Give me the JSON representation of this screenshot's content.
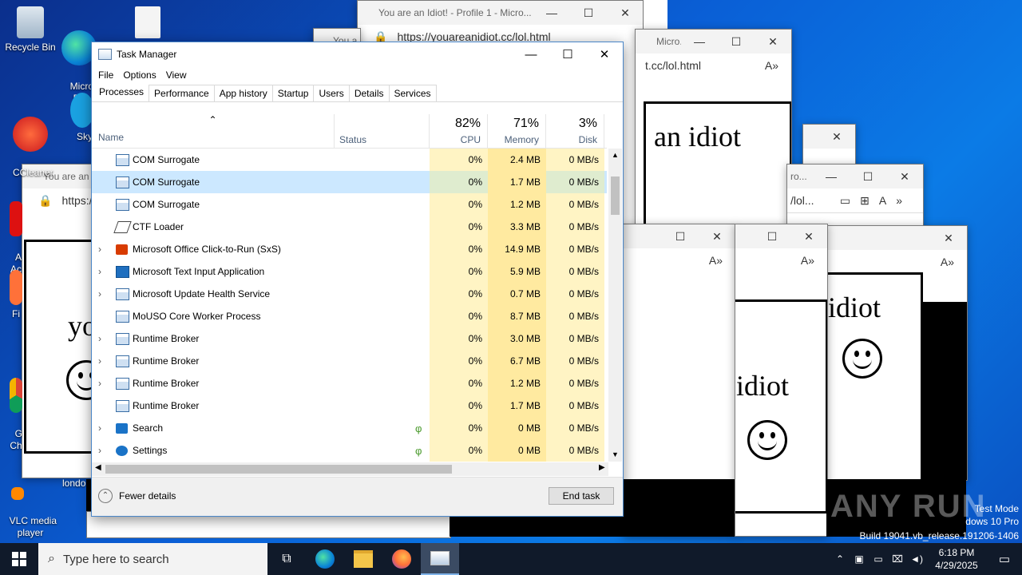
{
  "desktop": {
    "icons": [
      {
        "label": "Recycle Bin"
      },
      {
        "label": "Micro\nEd"
      },
      {
        "label": "CCleaner"
      },
      {
        "label": "Sky"
      },
      {
        "label": "A\nAc"
      },
      {
        "label": "Fi"
      },
      {
        "label": "Go\nCh"
      },
      {
        "label": "VLC media\nplayer"
      },
      {
        "label": "londo"
      }
    ],
    "watermark": {
      "brand": "ANY RUN",
      "mode": "Test Mode",
      "os": "dows 10 Pro",
      "build": "Build 19041.vb_release.191206-1406"
    }
  },
  "browsers": [
    {
      "title": "You are an Idiot! - Profile 1 - Micro...",
      "url": "https://youareanidiot.cc/lol.html",
      "text": ""
    },
    {
      "title": "Micro...",
      "url": "t.cc/lol.html",
      "text": "an idiot"
    },
    {
      "title": "You a",
      "url": "",
      "text": ""
    },
    {
      "title": "You are an I",
      "url": "https:/",
      "text": "yo"
    },
    {
      "title": "ro...",
      "url": "/lol...",
      "text": ""
    },
    {
      "title": "",
      "url": "",
      "text": "idiot"
    },
    {
      "title": "",
      "url": "",
      "text": "idiot"
    }
  ],
  "task_manager": {
    "title": "Task Manager",
    "menu": [
      "File",
      "Options",
      "View"
    ],
    "tabs": [
      "Processes",
      "Performance",
      "App history",
      "Startup",
      "Users",
      "Details",
      "Services"
    ],
    "columns": {
      "name": "Name",
      "status": "Status",
      "cpu": {
        "pct": "82%",
        "label": "CPU"
      },
      "memory": {
        "pct": "71%",
        "label": "Memory"
      },
      "disk": {
        "pct": "3%",
        "label": "Disk"
      }
    },
    "rows": [
      {
        "name": "COM Surrogate",
        "expand": "",
        "cpu": "0%",
        "mem": "2.4 MB",
        "disk": "0 MB/s",
        "icon": "app-window-icon"
      },
      {
        "name": "COM Surrogate",
        "expand": "",
        "cpu": "0%",
        "mem": "1.7 MB",
        "disk": "0 MB/s",
        "icon": "app-window-icon"
      },
      {
        "name": "COM Surrogate",
        "expand": "",
        "cpu": "0%",
        "mem": "1.2 MB",
        "disk": "0 MB/s",
        "icon": "app-window-icon"
      },
      {
        "name": "CTF Loader",
        "expand": "",
        "cpu": "0%",
        "mem": "3.3 MB",
        "disk": "0 MB/s",
        "icon": "pen-icon"
      },
      {
        "name": "Microsoft Office Click-to-Run (SxS)",
        "expand": "›",
        "cpu": "0%",
        "mem": "14.9 MB",
        "disk": "0 MB/s",
        "icon": "office-icon"
      },
      {
        "name": "Microsoft Text Input Application",
        "expand": "›",
        "cpu": "0%",
        "mem": "5.9 MB",
        "disk": "0 MB/s",
        "icon": "keyboard-icon"
      },
      {
        "name": "Microsoft Update Health Service",
        "expand": "›",
        "cpu": "0%",
        "mem": "0.7 MB",
        "disk": "0 MB/s",
        "icon": "app-window-icon"
      },
      {
        "name": "MoUSO Core Worker Process",
        "expand": "",
        "cpu": "0%",
        "mem": "8.7 MB",
        "disk": "0 MB/s",
        "icon": "app-window-icon"
      },
      {
        "name": "Runtime Broker",
        "expand": "›",
        "cpu": "0%",
        "mem": "3.0 MB",
        "disk": "0 MB/s",
        "icon": "app-window-icon"
      },
      {
        "name": "Runtime Broker",
        "expand": "›",
        "cpu": "0%",
        "mem": "6.7 MB",
        "disk": "0 MB/s",
        "icon": "app-window-icon"
      },
      {
        "name": "Runtime Broker",
        "expand": "›",
        "cpu": "0%",
        "mem": "1.2 MB",
        "disk": "0 MB/s",
        "icon": "app-window-icon"
      },
      {
        "name": "Runtime Broker",
        "expand": "",
        "cpu": "0%",
        "mem": "1.7 MB",
        "disk": "0 MB/s",
        "icon": "app-window-icon"
      },
      {
        "name": "Search",
        "expand": "›",
        "cpu": "0%",
        "mem": "0 MB",
        "disk": "0 MB/s",
        "icon": "search-icon",
        "leaf": "φ"
      },
      {
        "name": "Settings",
        "expand": "›",
        "cpu": "0%",
        "mem": "0 MB",
        "disk": "0 MB/s",
        "icon": "gear-icon",
        "leaf": "φ"
      }
    ],
    "selected_row_index": 1,
    "footer": {
      "fewer_details": "Fewer details",
      "end_task": "End task"
    }
  },
  "taskbar": {
    "search_placeholder": "Type here to search",
    "time": "6:18 PM",
    "date": "4/29/2025"
  },
  "colors": {
    "accent": "#0078d7",
    "cpu_heat": "#fff4c4",
    "memory_heat": "#ffeaa0",
    "selected": "#cce8ff"
  }
}
